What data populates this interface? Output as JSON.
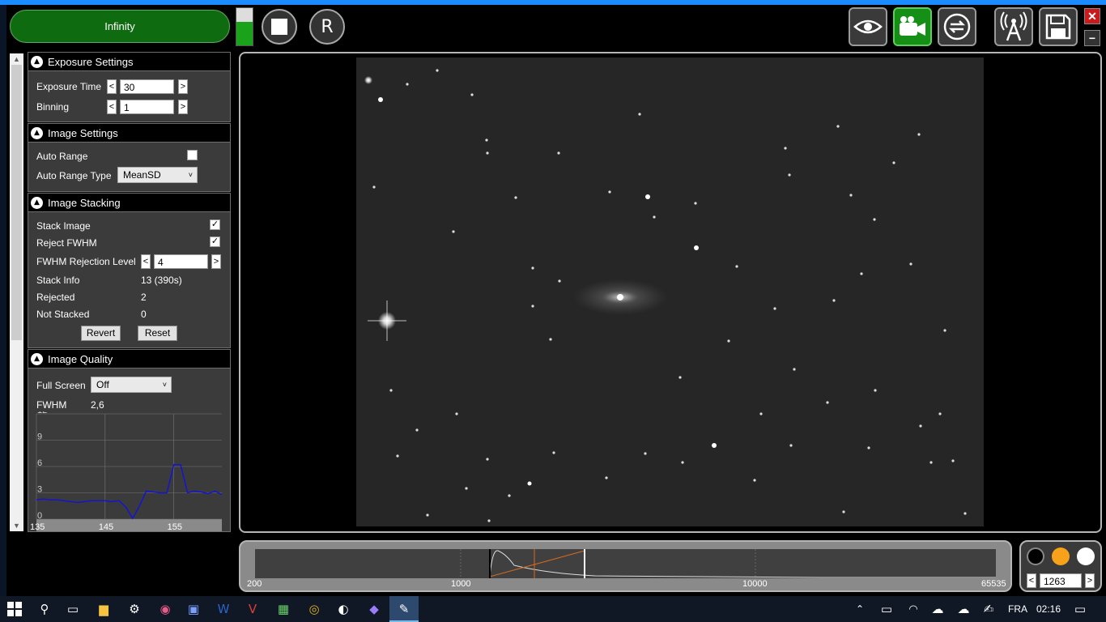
{
  "toolbar": {
    "sequence_label": "Infinity",
    "stop_label": "",
    "reset_label": "R",
    "gauge_level_percent": 62,
    "accent": "#158f15"
  },
  "exposure": {
    "title": "Exposure Settings",
    "exposure_time_label": "Exposure Time",
    "exposure_time_value": "30",
    "binning_label": "Binning",
    "binning_value": "1",
    "dec": "<",
    "inc": ">"
  },
  "image_settings": {
    "title": "Image Settings",
    "auto_range_label": "Auto Range",
    "auto_range_checked": false,
    "auto_range_type_label": "Auto Range Type",
    "auto_range_type_value": "MeanSD"
  },
  "stacking": {
    "title": "Image Stacking",
    "stack_image_label": "Stack Image",
    "stack_image_checked": true,
    "reject_fwhm_label": "Reject FWHM",
    "reject_fwhm_checked": true,
    "fwhm_rejection_label": "FWHM Rejection Level",
    "fwhm_rejection_value": "4",
    "stack_info_label": "Stack Info",
    "stack_info_value": "13 (390s)",
    "rejected_label": "Rejected",
    "rejected_value": "2",
    "not_stacked_label": "Not Stacked",
    "not_stacked_value": "0",
    "revert_label": "Revert",
    "reset_label": "Reset"
  },
  "image_quality": {
    "title": "Image Quality",
    "full_screen_label": "Full Screen",
    "full_screen_value": "Off",
    "fwhm_label": "FWHM",
    "fwhm_value": "2,6"
  },
  "chart_data": {
    "type": "line",
    "title": "",
    "xlabel": "",
    "ylabel": "",
    "xlim": [
      135,
      162
    ],
    "ylim": [
      0,
      12
    ],
    "x_ticks": [
      "135",
      "145",
      "155"
    ],
    "y_ticks": [
      "0",
      "3",
      "6",
      "9",
      "12"
    ],
    "grid": true,
    "series": [
      {
        "color": "#1414d2",
        "x": [
          135,
          136,
          137,
          138,
          139,
          140,
          141,
          142,
          143,
          144,
          145,
          146,
          147,
          148,
          149,
          150,
          151,
          152,
          153,
          154,
          155,
          156,
          157,
          158,
          159,
          160,
          161,
          162
        ],
        "y": [
          2.2,
          2.3,
          2.2,
          2.2,
          2.1,
          2.0,
          1.9,
          2.0,
          2.1,
          2.1,
          2.1,
          2.0,
          2.1,
          1.4,
          0.1,
          1.5,
          3.2,
          3.1,
          3.0,
          3.0,
          6.2,
          6.2,
          3.0,
          3.2,
          3.1,
          2.9,
          3.2,
          2.8
        ]
      }
    ]
  },
  "histogram": {
    "ticks": [
      "200",
      "1000",
      "10000",
      "65535"
    ],
    "black_point_value": "1263"
  },
  "color_controls": {
    "black": "#000000",
    "orange": "#f7a21a",
    "white": "#ffffff",
    "dec": "<",
    "inc": ">"
  },
  "taskbar": {
    "language": "FRA",
    "time": "02:16"
  }
}
